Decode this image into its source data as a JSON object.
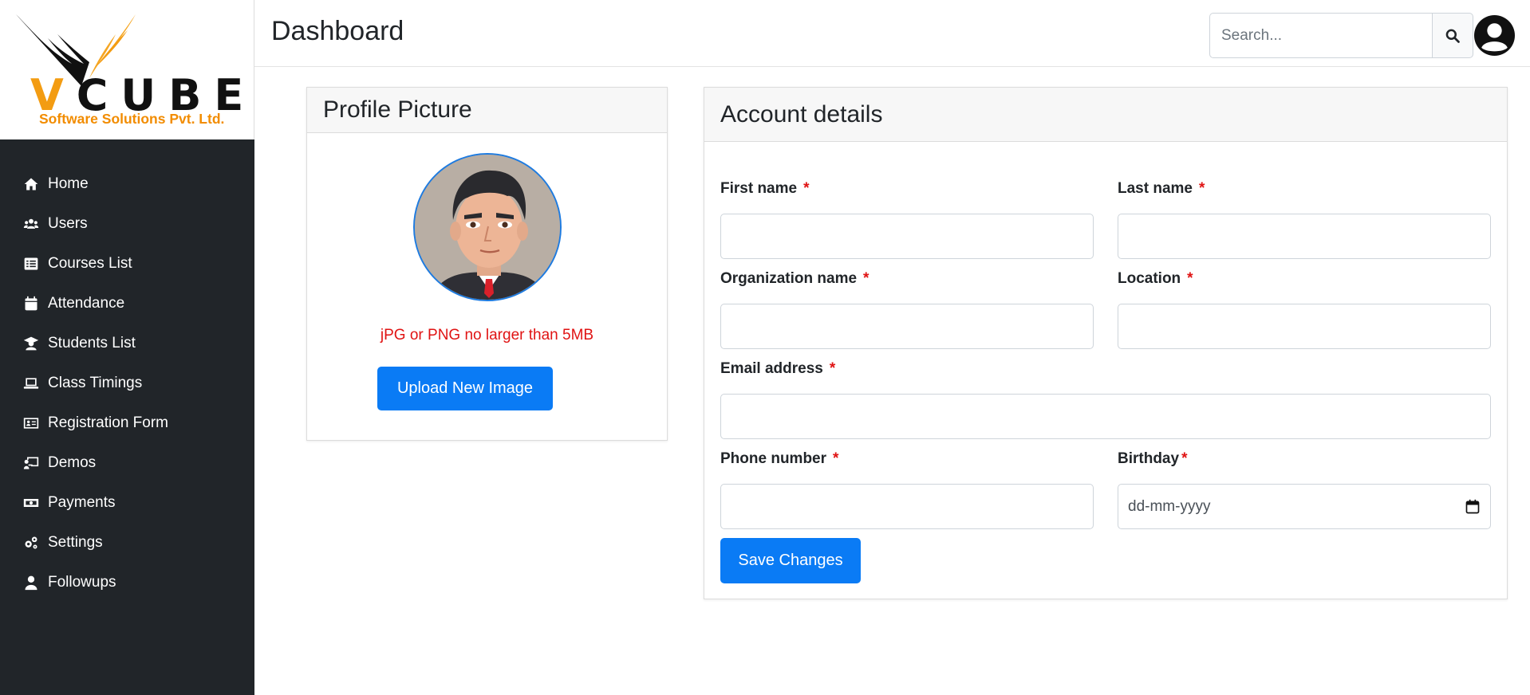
{
  "logo": {
    "brand_text": "V CUBE",
    "brand_letters": "CUBE",
    "brand_v": "V",
    "subtitle": "Software Solutions Pvt. Ltd."
  },
  "sidebar": {
    "items": [
      {
        "label": "Home",
        "icon": "home-icon"
      },
      {
        "label": "Users",
        "icon": "users-icon"
      },
      {
        "label": "Courses List",
        "icon": "list-icon"
      },
      {
        "label": "Attendance",
        "icon": "calendar-icon"
      },
      {
        "label": "Students List",
        "icon": "graduate-icon"
      },
      {
        "label": "Class Timings",
        "icon": "laptop-icon"
      },
      {
        "label": "Registration Form",
        "icon": "id-card-icon"
      },
      {
        "label": "Demos",
        "icon": "chalkboard-icon"
      },
      {
        "label": "Payments",
        "icon": "money-icon"
      },
      {
        "label": "Settings",
        "icon": "gears-icon"
      },
      {
        "label": "Followups",
        "icon": "user-icon"
      }
    ]
  },
  "header": {
    "title": "Dashboard",
    "search_placeholder": "Search...",
    "search_icon": "search-icon",
    "avatar_icon": "user-circle-icon"
  },
  "profile_card": {
    "title": "Profile Picture",
    "hint": "jPG or PNG no larger than 5MB",
    "upload_label": "Upload New Image"
  },
  "account_card": {
    "title": "Account details",
    "fields": {
      "first_name": {
        "label": "First name",
        "required": "*",
        "value": ""
      },
      "last_name": {
        "label": "Last name",
        "required": "*",
        "value": ""
      },
      "organization": {
        "label": "Organization name",
        "required": "*",
        "value": ""
      },
      "location": {
        "label": "Location",
        "required": "*",
        "value": ""
      },
      "email": {
        "label": "Email address",
        "required": "*",
        "value": ""
      },
      "phone": {
        "label": "Phone number",
        "required": "*",
        "value": ""
      },
      "birthday": {
        "label": "Birthday",
        "required": "*",
        "placeholder": "dd-mm-yyyy"
      }
    },
    "save_label": "Save Changes"
  },
  "colors": {
    "sidebar_bg": "#212529",
    "primary": "#0a7bf5",
    "required": "#e01313",
    "brand_orange": "#f28c00"
  }
}
